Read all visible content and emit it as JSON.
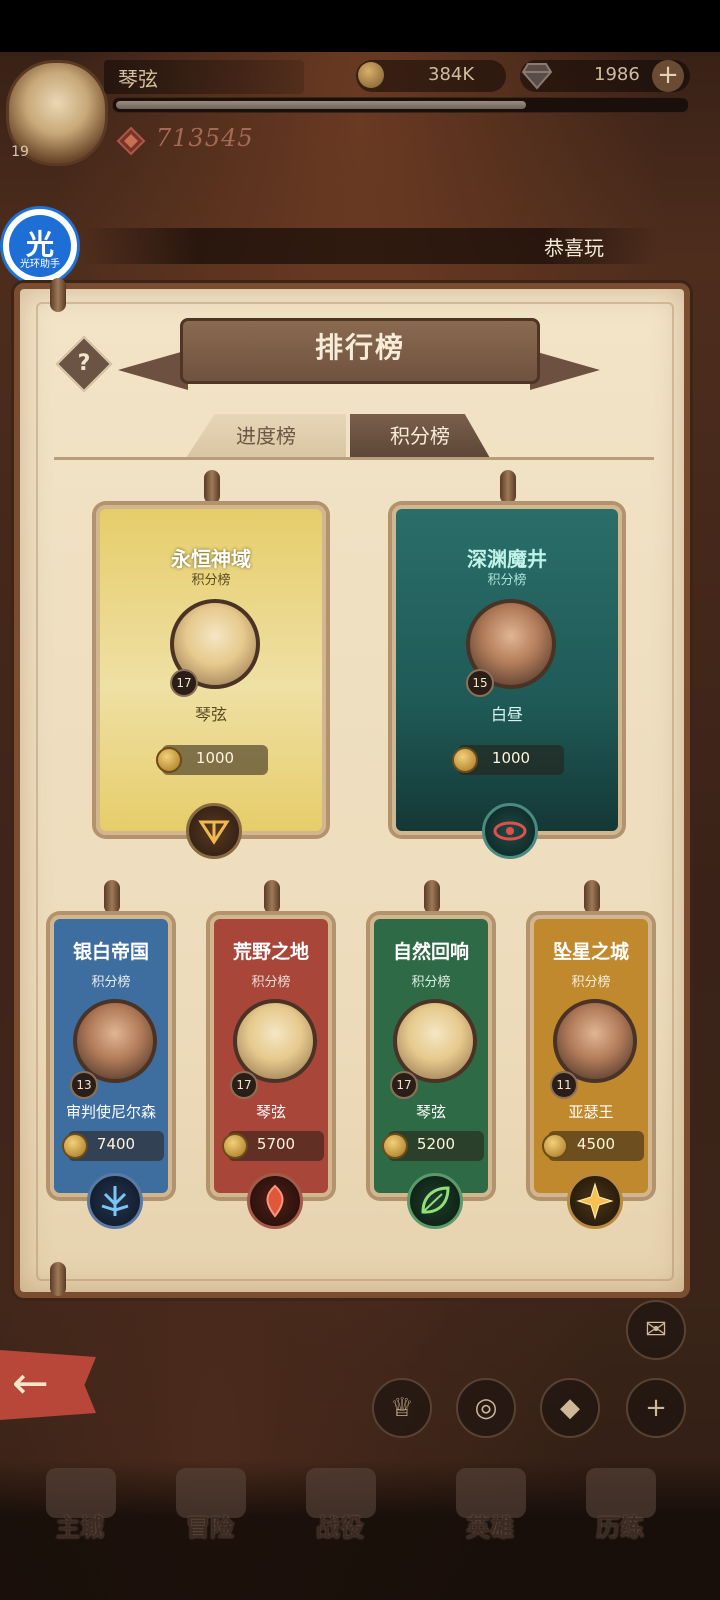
{
  "player": {
    "name": "琴弦",
    "level": "19",
    "power": "713545",
    "xp_fraction": 0.72
  },
  "currency": {
    "gold": "384K",
    "gems": "1986",
    "add_symbol": "+"
  },
  "assistant": {
    "glyph": "光",
    "label": "光环助手"
  },
  "marquee_text": "恭喜玩",
  "panel": {
    "title": "排行榜",
    "help_symbol": "?",
    "tabs": [
      {
        "label": "进度榜",
        "active": false
      },
      {
        "label": "积分榜",
        "active": true
      }
    ]
  },
  "top_cards": [
    {
      "faction": "永恒神域",
      "subtitle": "积分榜",
      "player": "琴弦",
      "level": "17",
      "score": "1000",
      "theme": "#e6cd6a",
      "emblem_icon": "celestial-icon"
    },
    {
      "faction": "深渊魔井",
      "subtitle": "积分榜",
      "player": "白昼",
      "level": "15",
      "score": "1000",
      "theme": "#1f5a57",
      "emblem_icon": "eye-icon"
    }
  ],
  "bottom_cards": [
    {
      "faction": "银白帝国",
      "subtitle": "积分榜",
      "player": "审判使尼尔森",
      "level": "13",
      "score": "7400",
      "theme": "#3e6ea0",
      "emblem_icon": "lightbearer-icon"
    },
    {
      "faction": "荒野之地",
      "subtitle": "积分榜",
      "player": "琴弦",
      "level": "17",
      "score": "5700",
      "theme": "#a8463a",
      "emblem_icon": "mauler-icon"
    },
    {
      "faction": "自然回响",
      "subtitle": "积分榜",
      "player": "琴弦",
      "level": "17",
      "score": "5200",
      "theme": "#2f6a47",
      "emblem_icon": "leaf-icon"
    },
    {
      "faction": "坠星之城",
      "subtitle": "积分榜",
      "player": "亚瑟王",
      "level": "11",
      "score": "4500",
      "theme": "#c1892e",
      "emblem_icon": "star-icon"
    }
  ],
  "bottom_nav": [
    {
      "label": "主城"
    },
    {
      "label": "冒险"
    },
    {
      "label": "战役"
    },
    {
      "label": "英雄"
    },
    {
      "label": "历练"
    }
  ]
}
